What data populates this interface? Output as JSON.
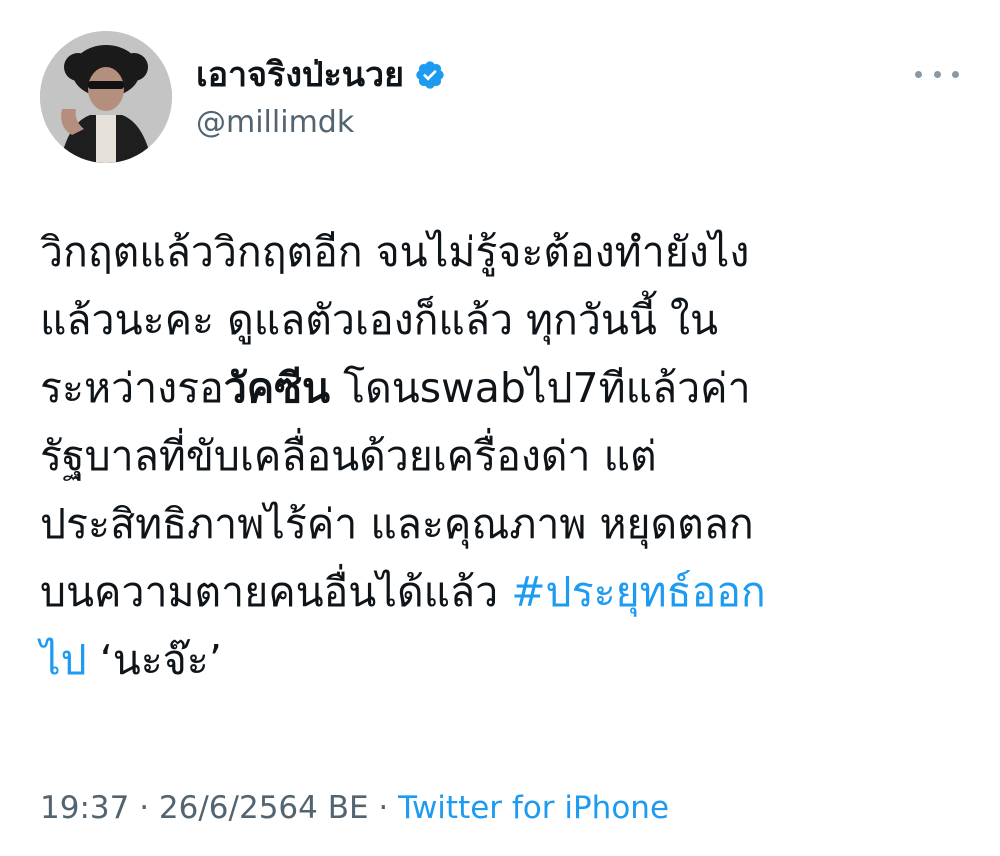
{
  "author": {
    "display_name": "เอาจริงป่ะนวย",
    "handle": "@millimdk",
    "verified_icon": "verified-badge-icon",
    "colors": {
      "verified": "#1d9bf0"
    }
  },
  "tweet": {
    "lines": [
      {
        "text": "วิกฤตแล้ววิกฤตอีก จนไม่รู้จะต้องทำยังไง"
      },
      {
        "text": "แล้วนะคะ ดูแลตัวเองก็แล้ว ทุกวันนี้ ใน"
      },
      {
        "pre": "ระหว่างรอ",
        "bold": "วัคซีน",
        "post": " โดนswabไป7ทีแล้วค่า"
      },
      {
        "text": "รัฐบาลที่ขับเคลื่อนด้วยเครื่องด่า แต่"
      },
      {
        "text": "ประสิทธิภาพไร้ค่า และคุณภาพ หยุดตลก"
      },
      {
        "pre": "บนความตายคนอื่นได้แล้ว ",
        "hashtag": "#ประยุทธ์ออก"
      },
      {
        "hashtag": "ไป",
        "post": " ‘นะจ๊ะ’"
      }
    ],
    "hashtag_color": "#1d9bf0"
  },
  "meta": {
    "time": "19:37",
    "separator": " · ",
    "date": "26/6/2564 BE",
    "separator2": " · ",
    "source": "Twitter for iPhone"
  },
  "more_icon": "more-horizontal-icon"
}
